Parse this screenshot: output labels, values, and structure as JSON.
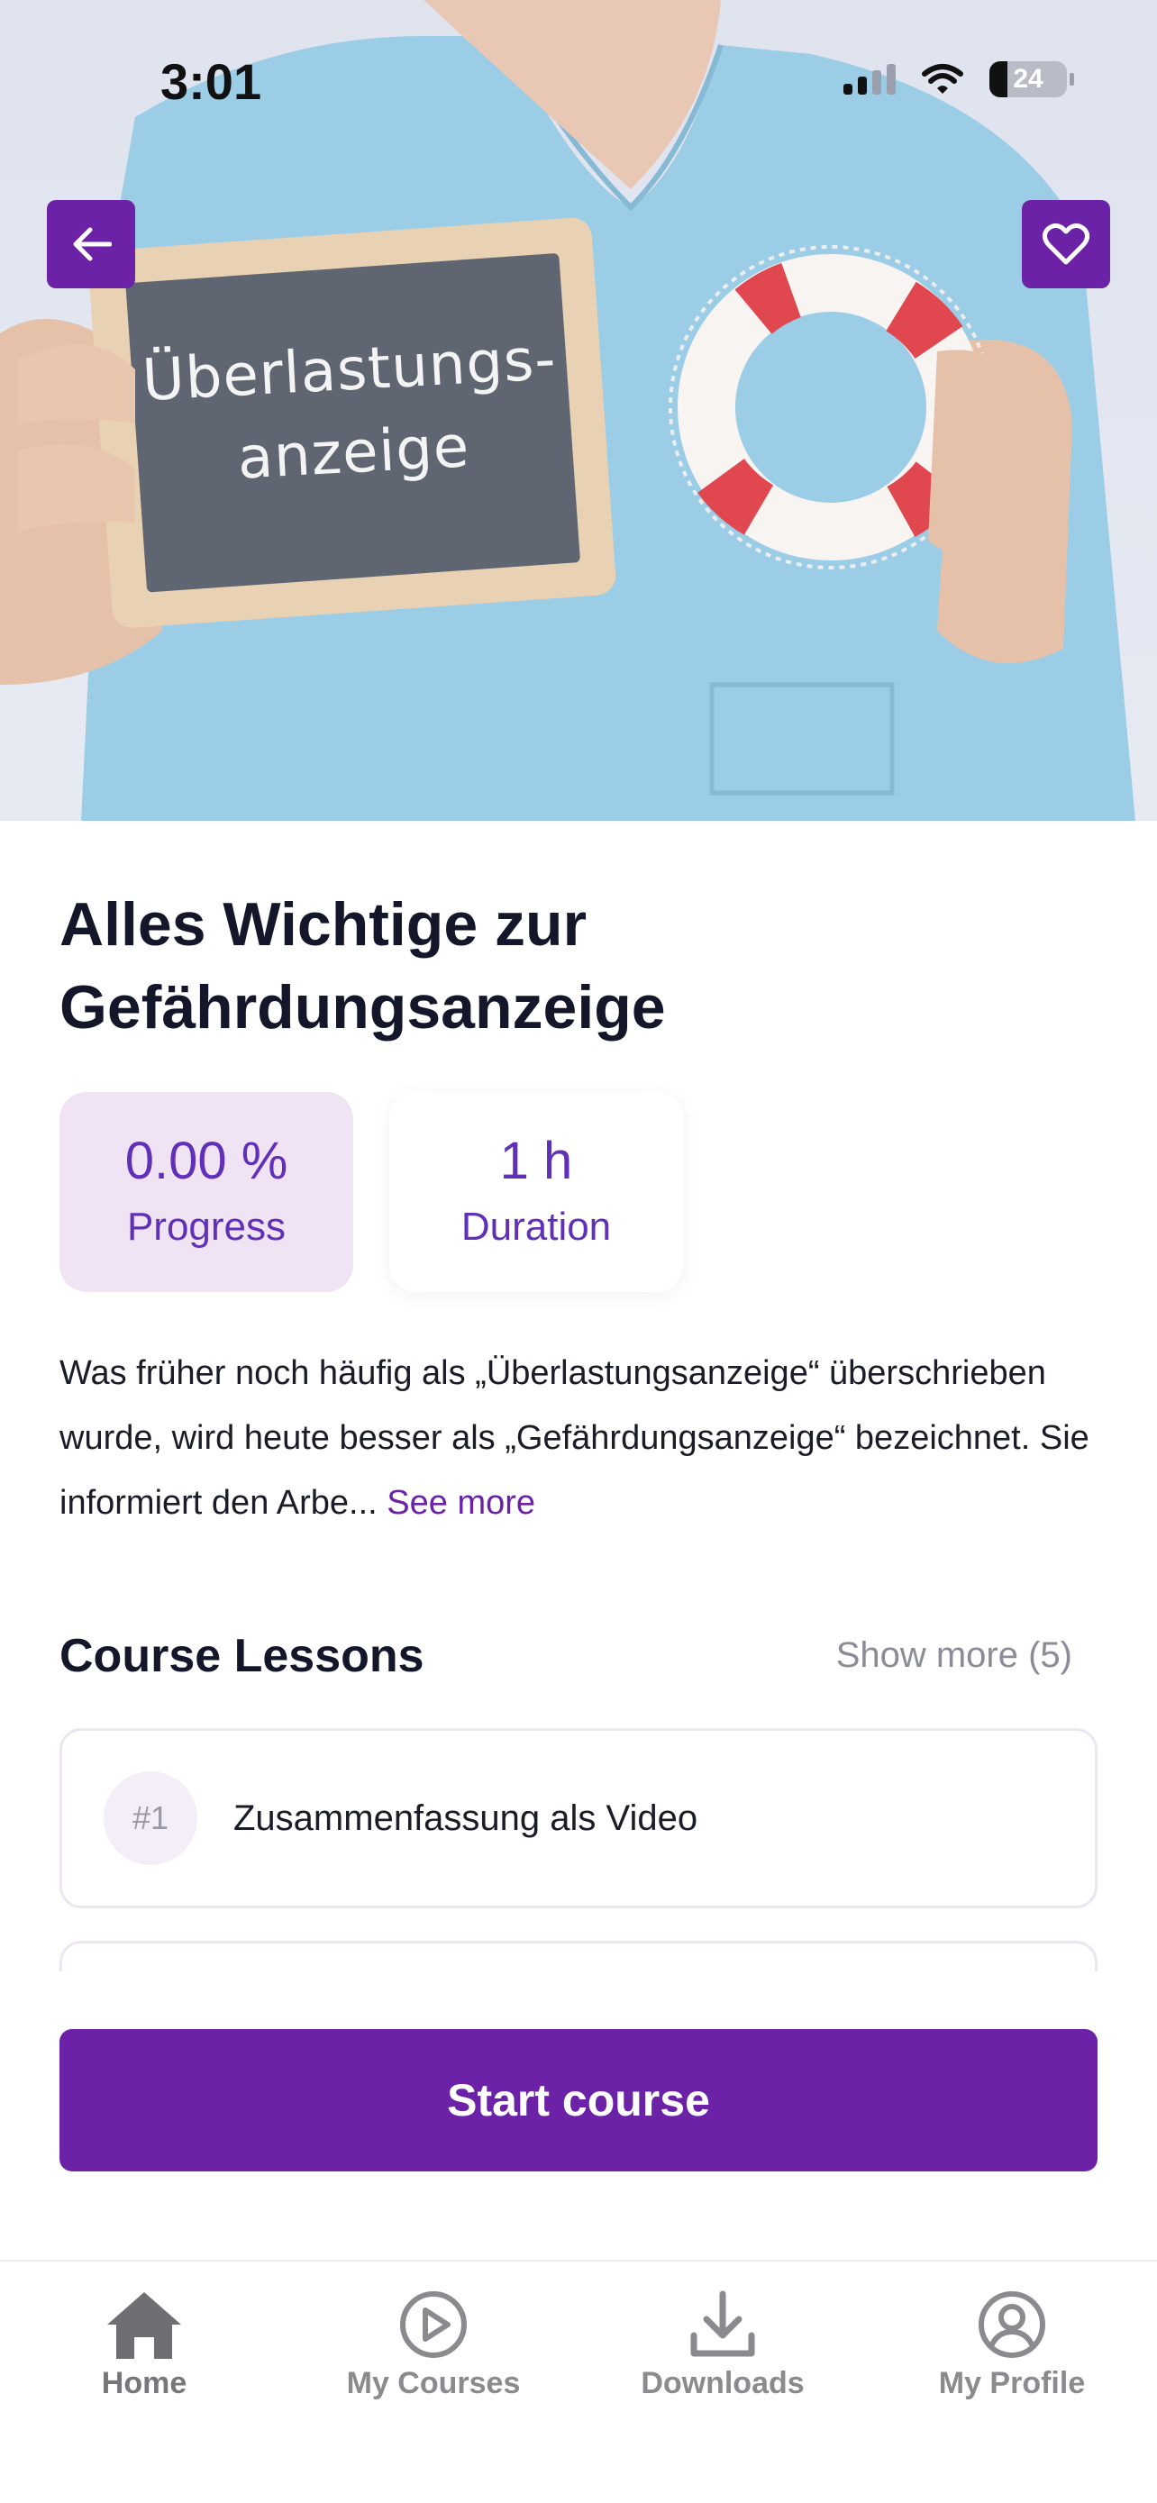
{
  "status_bar": {
    "time": "3:01",
    "battery": "24"
  },
  "hero": {
    "sign_text": "Überlastungs-\nanzeige",
    "back_icon": "arrow-left-icon",
    "favorite_icon": "heart-outline-icon"
  },
  "course": {
    "title": "Alles Wichtige zur Gefährdungsanzeige",
    "progress_value": "0.00 %",
    "progress_label": "Progress",
    "duration_value": "1 h",
    "duration_label": "Duration",
    "description": "Was früher noch häufig als „Überlastungsanzeige“ überschrieben wurde, wird heute besser als „Gefährdungsanzeige“ bezeichnet. Sie informiert den Arbe...",
    "see_more": "See more"
  },
  "lessons": {
    "section_title": "Course Lessons",
    "show_more": "Show more (5)",
    "items": [
      {
        "number": "#1",
        "title": "Zusammenfassung als Video"
      }
    ]
  },
  "cta": {
    "label": "Start course"
  },
  "colors": {
    "accent": "#6b22a6",
    "progress_bg": "#efe3f4",
    "stat_text": "#6130b8"
  },
  "bottom_nav": {
    "items": [
      {
        "label": "Home",
        "icon": "home-icon"
      },
      {
        "label": "My Courses",
        "icon": "play-circle-icon"
      },
      {
        "label": "Downloads",
        "icon": "download-icon"
      },
      {
        "label": "My Profile",
        "icon": "profile-icon"
      }
    ]
  }
}
